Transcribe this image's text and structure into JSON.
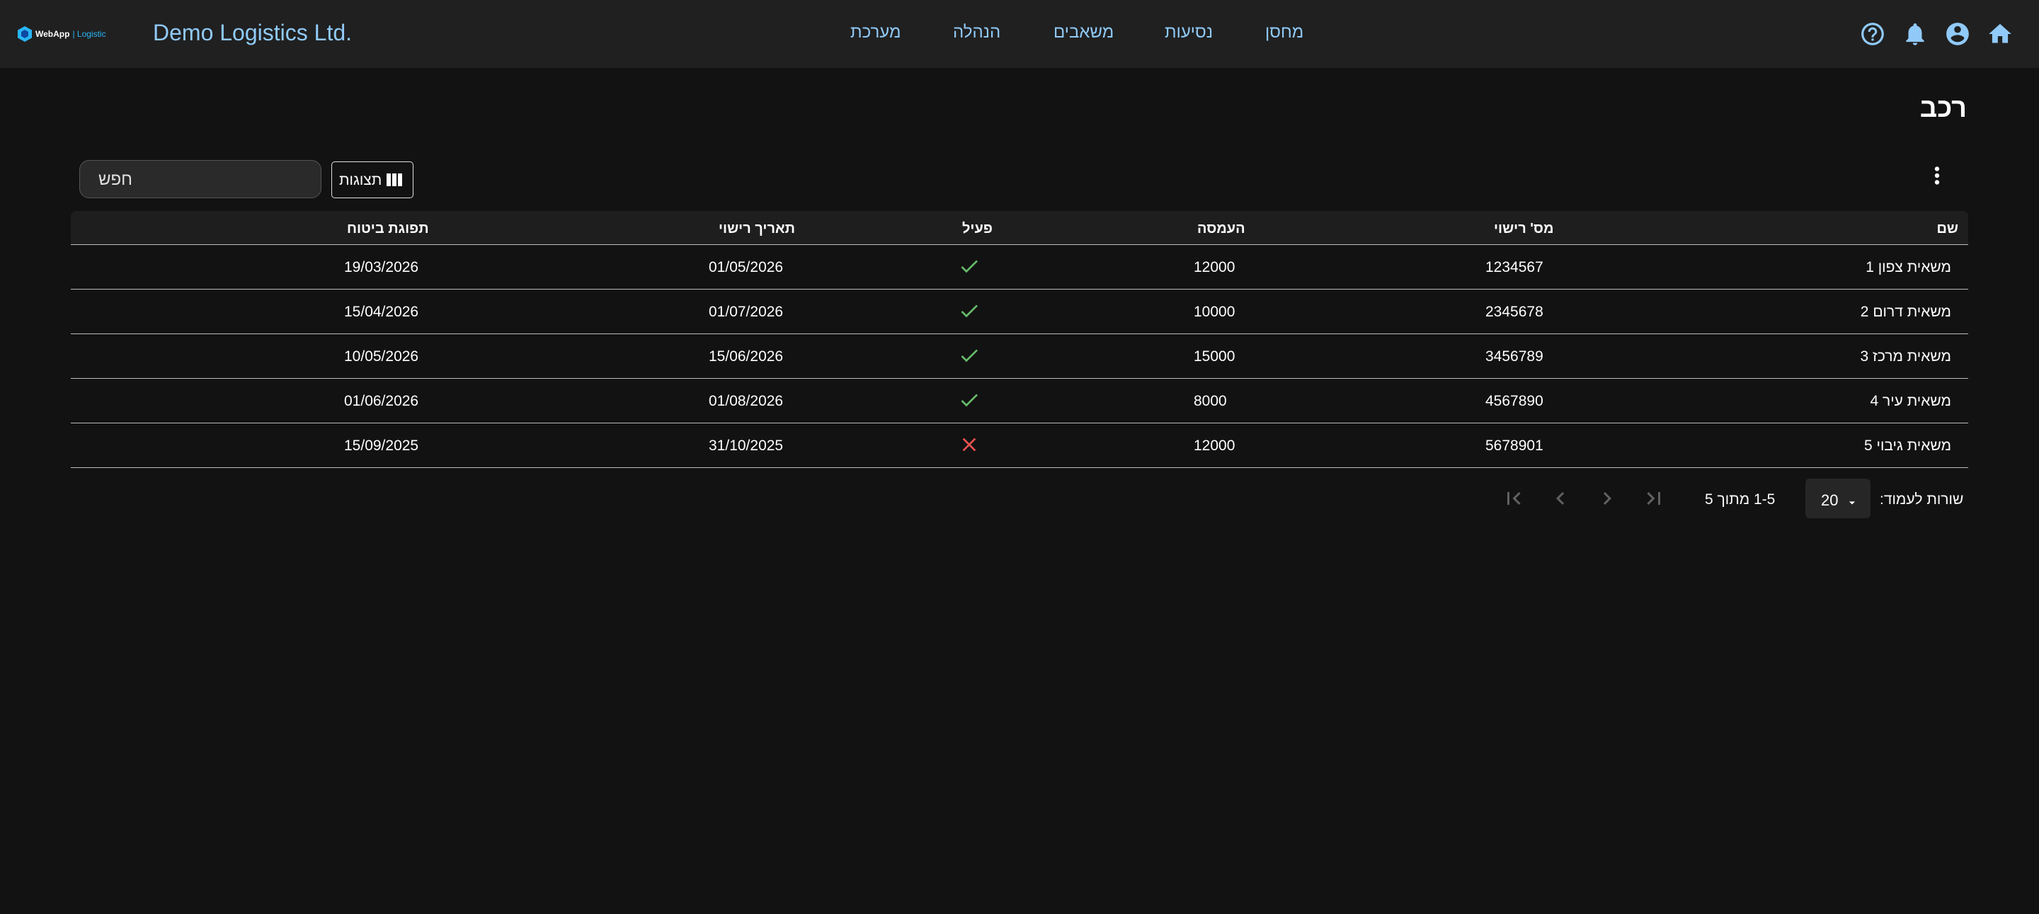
{
  "appbar": {
    "logo_web": "WebApp",
    "logo_logistic": "| Logistic",
    "brand": "Demo Logistics Ltd.",
    "nav": [
      "מחסן",
      "נסיעות",
      "משאבים",
      "הנהלה",
      "מערכת"
    ],
    "icons": [
      "home-icon",
      "account-icon",
      "notifications-icon",
      "help-icon"
    ]
  },
  "page": {
    "title": "רכב"
  },
  "toolbar": {
    "search_placeholder": "חפש",
    "views_label": "תצוגות"
  },
  "table": {
    "headers": {
      "name": "שם",
      "plate": "מס' רישוי",
      "load": "העמסה",
      "active": "פעיל",
      "registration": "תאריך רישוי",
      "insurance": "תפוגת ביטוח"
    },
    "rows": [
      {
        "name": "משאית צפון 1",
        "plate": "1234567",
        "load": "12000",
        "active": true,
        "registration": "01/05/2026",
        "insurance": "19/03/2026"
      },
      {
        "name": "משאית דרום 2",
        "plate": "2345678",
        "load": "10000",
        "active": true,
        "registration": "01/07/2026",
        "insurance": "15/04/2026"
      },
      {
        "name": "משאית מרכז 3",
        "plate": "3456789",
        "load": "15000",
        "active": true,
        "registration": "15/06/2026",
        "insurance": "10/05/2026"
      },
      {
        "name": "משאית עיר 4",
        "plate": "4567890",
        "load": "8000",
        "active": true,
        "registration": "01/08/2026",
        "insurance": "01/06/2026"
      },
      {
        "name": "משאית גיבוי 5",
        "plate": "5678901",
        "load": "12000",
        "active": false,
        "registration": "31/10/2025",
        "insurance": "15/09/2025"
      }
    ]
  },
  "pagination": {
    "rows_per_page_label": "שורות לעמוד:",
    "rows_per_page": "20",
    "range": "1-5 מתוך 5"
  },
  "colors": {
    "accent": "#90caf9",
    "check": "#66bb6a",
    "cross": "#ef5350",
    "background": "#121212",
    "appbar": "#202020"
  }
}
